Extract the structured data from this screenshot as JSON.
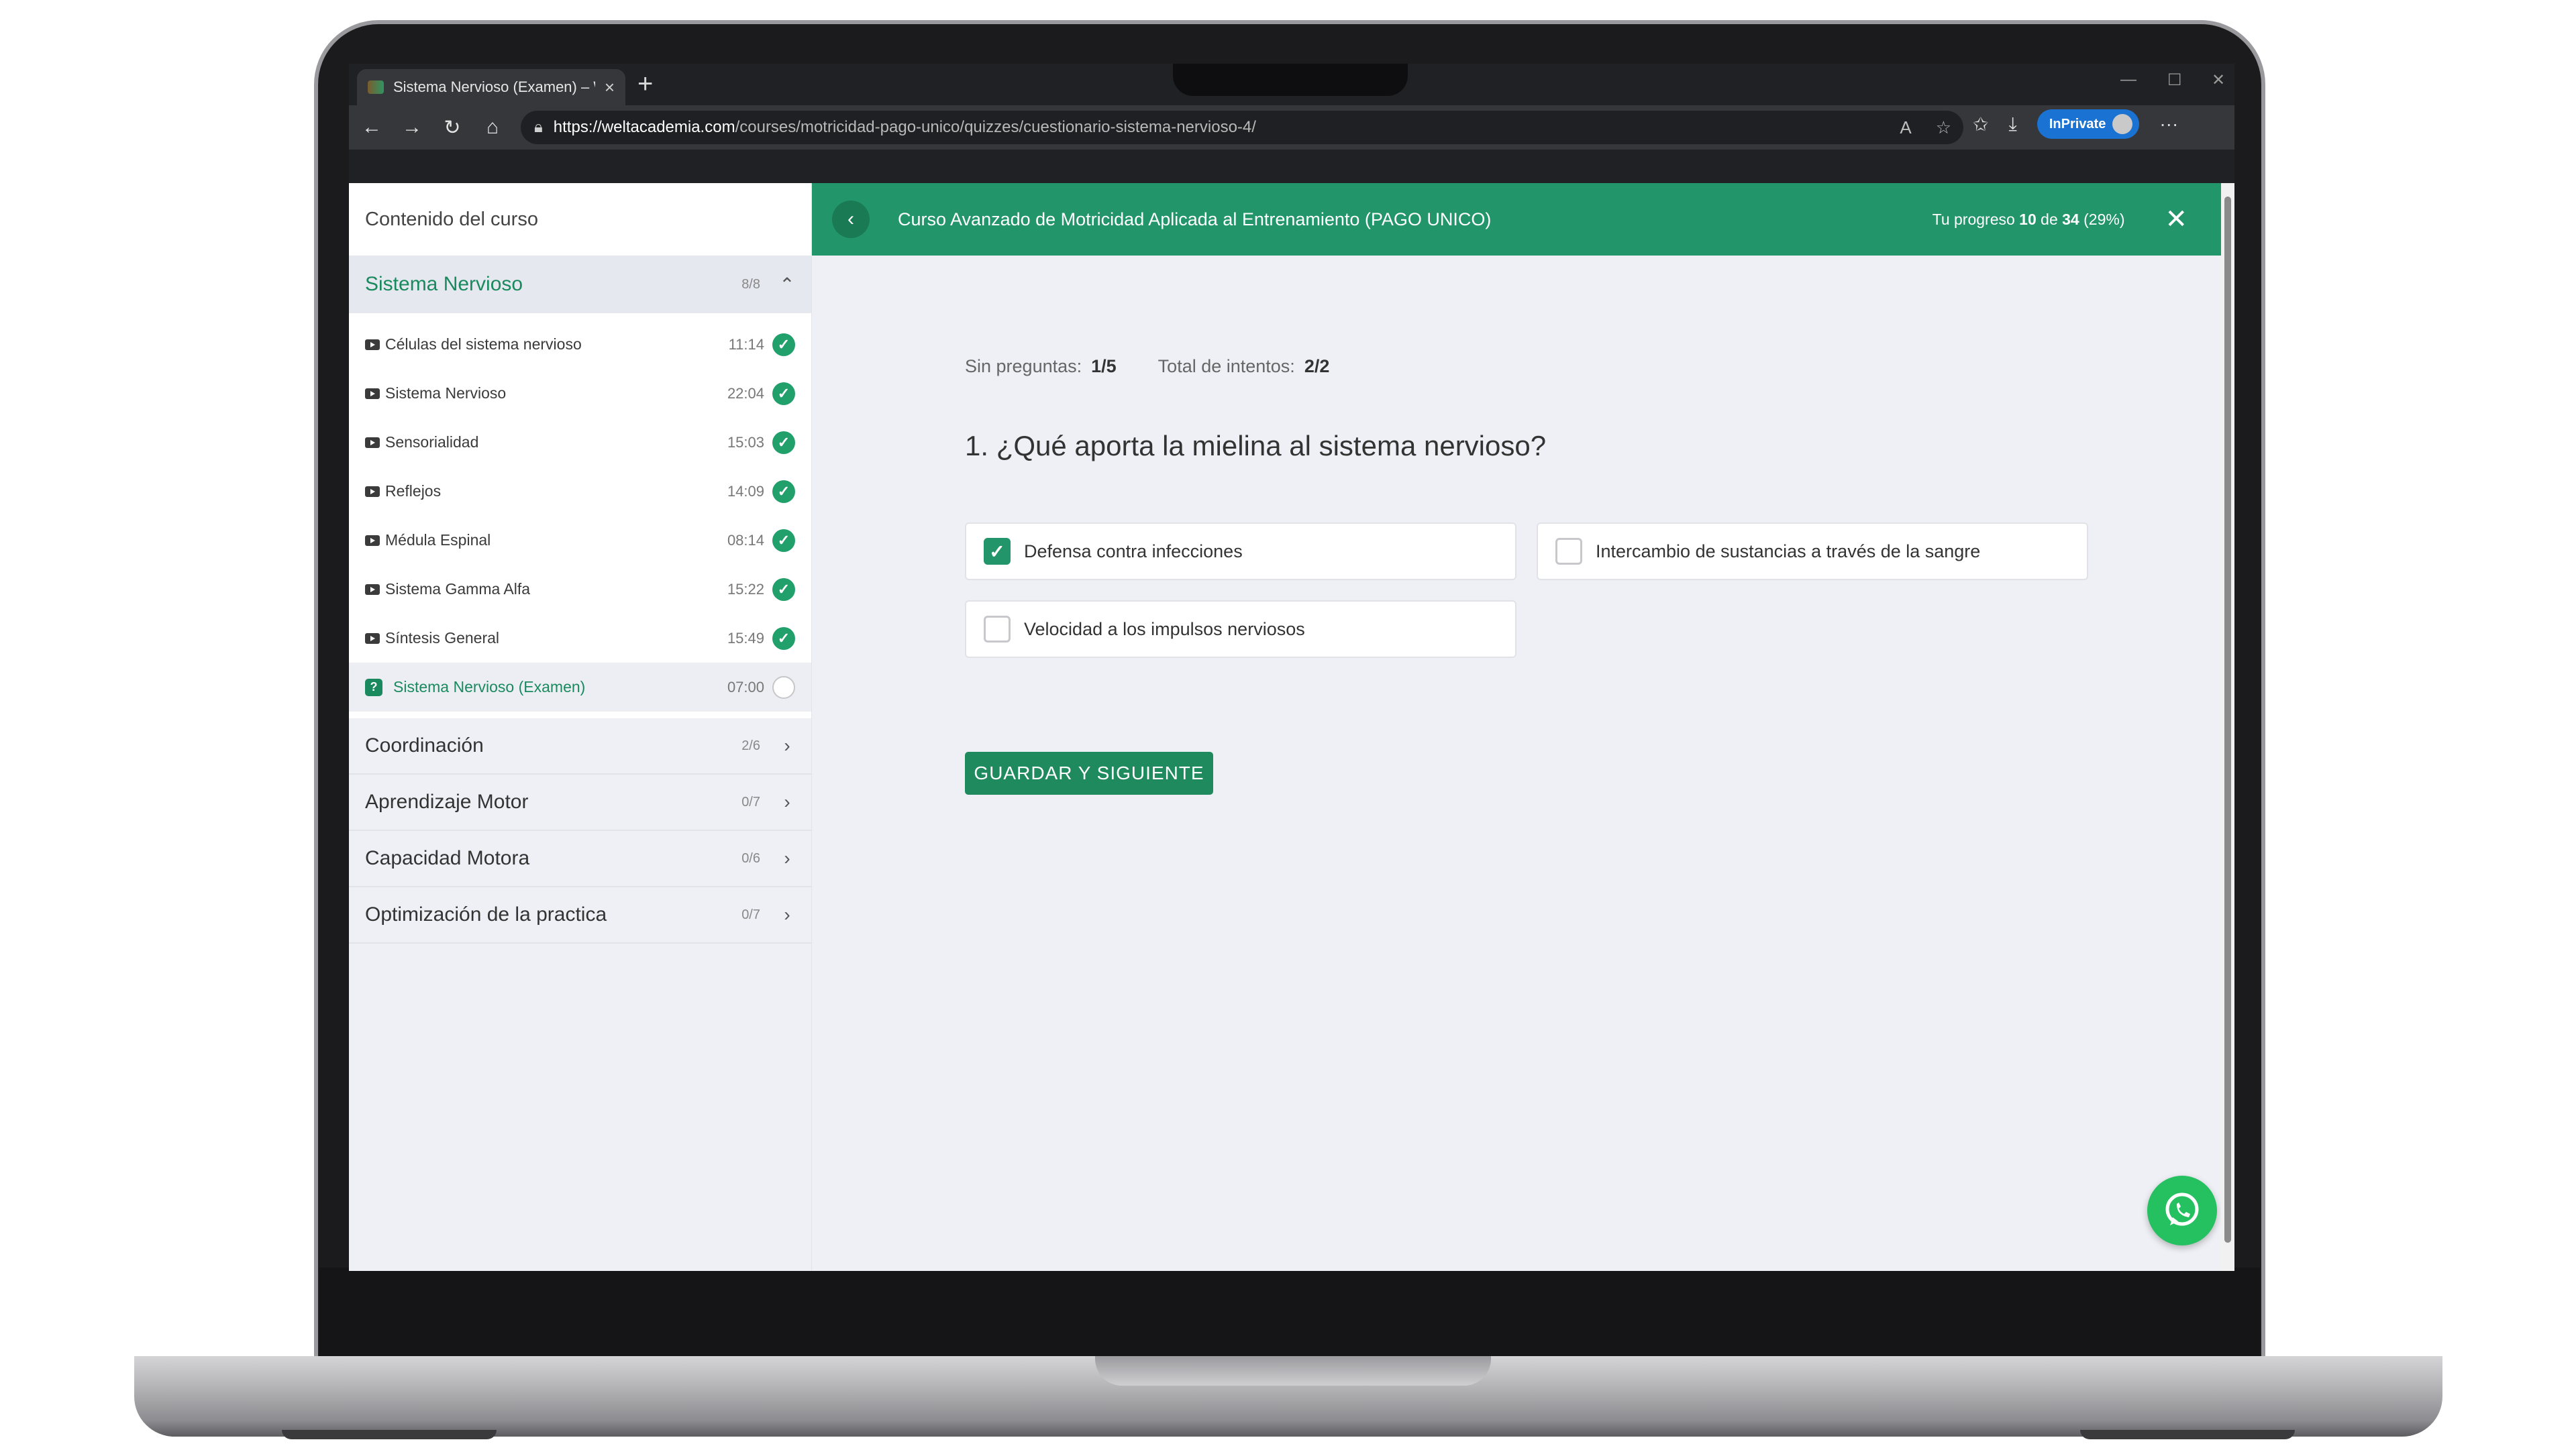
{
  "browser": {
    "tab_title": "Sistema Nervioso (Examen) – Wel",
    "tab_close": "×",
    "new_tab": "+",
    "url_domain": "https://weltacademia.com",
    "url_path": "/courses/motricidad-pago-unico/quizzes/cuestionario-sistema-nervioso-4/",
    "inprivate_label": "InPrivate",
    "more_label": "···",
    "icons": [
      "back-icon",
      "forward-icon",
      "refresh-icon",
      "home-icon",
      "lock-icon",
      "read-aloud-icon",
      "favorite-star-icon",
      "favorites-icon",
      "download-icon"
    ]
  },
  "sidebar": {
    "title": "Contenido del curso",
    "open_section": {
      "label": "Sistema Nervioso",
      "count": "8/8"
    },
    "lessons": [
      {
        "label": "Células del sistema nervioso",
        "time": "11:14",
        "done": true
      },
      {
        "label": "Sistema Nervioso",
        "time": "22:04",
        "done": true
      },
      {
        "label": "Sensorialidad",
        "time": "15:03",
        "done": true
      },
      {
        "label": "Reflejos",
        "time": "14:09",
        "done": true
      },
      {
        "label": "Médula Espinal",
        "time": "08:14",
        "done": true
      },
      {
        "label": "Sistema Gamma Alfa",
        "time": "15:22",
        "done": true
      },
      {
        "label": "Síntesis General",
        "time": "15:49",
        "done": true
      }
    ],
    "active_lesson": {
      "label": "Sistema Nervioso (Examen)",
      "time": "07:00"
    },
    "sections": [
      {
        "label": "Coordinación",
        "count": "2/6"
      },
      {
        "label": "Aprendizaje Motor",
        "count": "0/7"
      },
      {
        "label": "Capacidad Motora",
        "count": "0/6"
      },
      {
        "label": "Optimización de la practica",
        "count": "0/7"
      }
    ]
  },
  "header": {
    "course_title": "Curso Avanzado de Motricidad Aplicada al Entrenamiento (PAGO UNICO)",
    "progress_prefix": "Tu progreso",
    "progress_done": "10",
    "progress_of": "de",
    "progress_total": "34",
    "progress_pct": "(29%)"
  },
  "quiz": {
    "questions_label": "Sin preguntas:",
    "questions_value": "1/5",
    "attempts_label": "Total de intentos:",
    "attempts_value": "2/2",
    "question": "1. ¿Qué aporta la mielina al sistema nervioso?",
    "options": [
      {
        "label": "Defensa contra infecciones",
        "checked": true
      },
      {
        "label": "Intercambio de sustancias a través de la sangre",
        "checked": false
      },
      {
        "label": "Velocidad a los impulsos nerviosos",
        "checked": false
      }
    ],
    "save_button": "GUARDAR Y SIGUIENTE"
  },
  "colors": {
    "brand_green": "#22956a",
    "check_green": "#22a06b",
    "whatsapp": "#25c060",
    "inprivate_blue": "#1a73d2"
  }
}
